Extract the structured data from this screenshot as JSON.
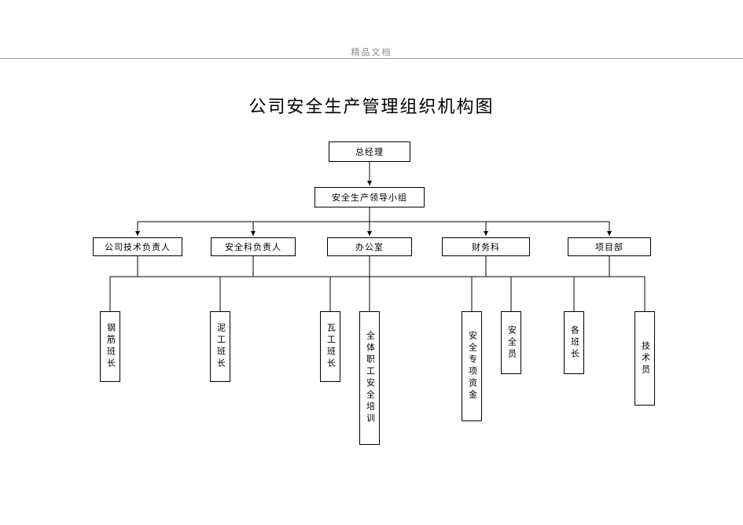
{
  "header": "精品文档",
  "title": "公司安全生产管理组织机构图",
  "level1": {
    "gm": "总经理"
  },
  "level2": {
    "safety_group": "安全生产领导小组"
  },
  "level3": {
    "tech_lead": "公司技术负责人",
    "safety_head": "安全科负责人",
    "office": "办公室",
    "finance": "财务科",
    "project": "项目部"
  },
  "level4": {
    "b1": "钢筋班长",
    "b2": "泥工班长",
    "b3": "瓦工班长",
    "b4": "全体职工安全培训",
    "b5": "安全专项资金",
    "b6": "安全员",
    "b7": "各班长",
    "b8": "技术员"
  }
}
